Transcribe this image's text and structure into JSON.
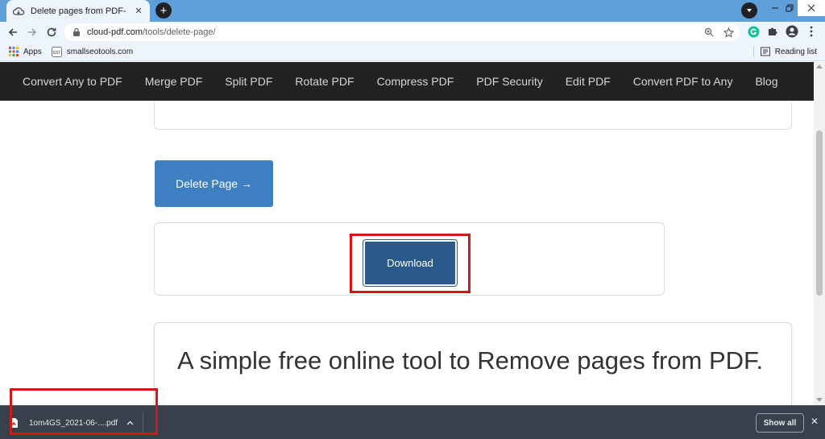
{
  "browser": {
    "tab_title": "Delete pages from PDF- Remove",
    "tab_close": "✕",
    "new_tab": "+",
    "url_host": "cloud-pdf.com",
    "url_path": "/tools/delete-page/",
    "bookmarks": [
      {
        "label": "Apps",
        "icon": "apps-grid-icon"
      },
      {
        "label": "smallseotools.com",
        "icon": "sst-favicon-icon"
      }
    ],
    "reading_list": "Reading list",
    "accent": "#5f9fd9"
  },
  "site_nav": {
    "items": [
      "Convert Any to PDF",
      "Merge PDF",
      "Split PDF",
      "Rotate PDF",
      "Compress PDF",
      "PDF Security",
      "Edit PDF",
      "Convert PDF to Any",
      "Blog"
    ]
  },
  "main": {
    "delete_button": "Delete Page →",
    "download_button": "Download",
    "heading": "A simple free online tool to Remove pages from PDF.",
    "primary_color": "#3e7fc1",
    "download_color": "#2a5a8c",
    "highlight_color": "#d01818"
  },
  "download_shelf": {
    "file_name": "1om4GS_2021-06-....pdf",
    "caret": "^",
    "show_all": "Show all",
    "close": "✕"
  }
}
